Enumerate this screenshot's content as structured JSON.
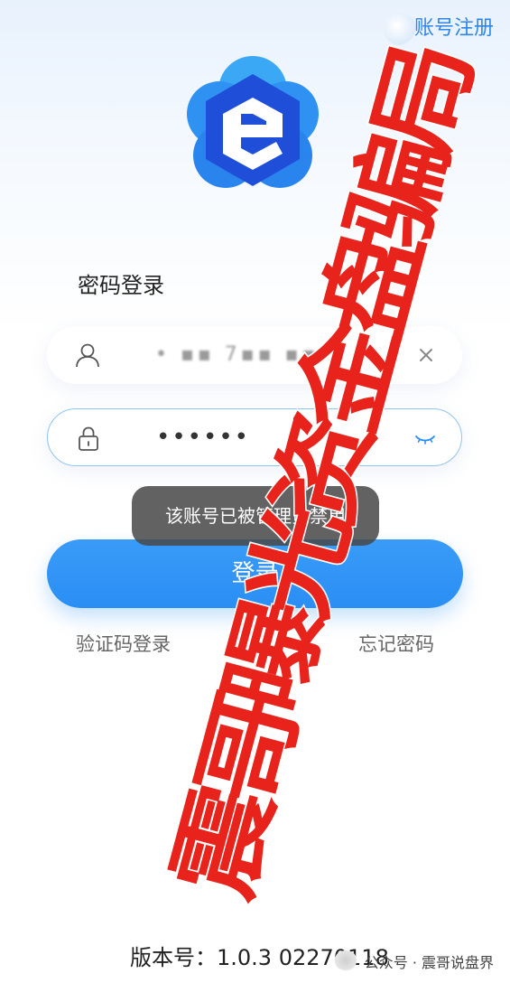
{
  "header": {
    "register_label": "账号注册"
  },
  "login": {
    "title": "密码登录",
    "username_value": "• ▪▪ 7▪▪ ▪▪",
    "password_value": "••••••",
    "toast": "该账号已被管理员禁用",
    "login_button": "登录",
    "sms_login": "验证码登录",
    "forgot_password": "忘记密码"
  },
  "overlay": {
    "watermark_text": "震哥曝光资金盘骗局",
    "watermark_color": "#e8231c"
  },
  "footer": {
    "version": "版本号：1.0.3 02270118",
    "source": "公众号 · 震哥说盘界"
  },
  "colors": {
    "accent": "#2a8ef4",
    "logo_dark": "#1f4fd8",
    "logo_light": "#38a9f5"
  }
}
